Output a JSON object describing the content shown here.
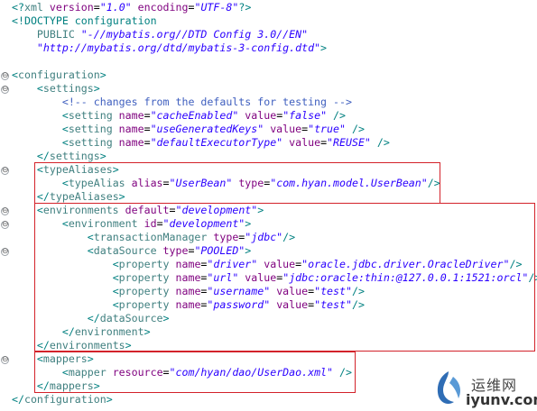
{
  "editor": {
    "lines": [
      [
        [
          "t-bracket",
          "<?"
        ],
        [
          "t-tag",
          "xml "
        ],
        [
          "t-attr",
          "version"
        ],
        [
          "t-plain",
          "="
        ],
        [
          "t-val",
          "\"1.0\""
        ],
        [
          "t-plain",
          " "
        ],
        [
          "t-attr",
          "encoding"
        ],
        [
          "t-plain",
          "="
        ],
        [
          "t-val",
          "\"UTF-8\""
        ],
        [
          "t-bracket",
          "?>"
        ]
      ],
      [
        [
          "t-bracket",
          "<!"
        ],
        [
          "t-doctype",
          "DOCTYPE configuration"
        ]
      ],
      [
        [
          "t-plain",
          "    "
        ],
        [
          "t-dtd",
          "PUBLIC "
        ],
        [
          "t-val",
          "\"-//mybatis.org//DTD Config 3.0//EN\""
        ]
      ],
      [
        [
          "t-plain",
          "    "
        ],
        [
          "t-val",
          "\"http://mybatis.org/dtd/mybatis-3-config.dtd\""
        ],
        [
          "t-bracket",
          ">"
        ]
      ],
      [
        [
          "t-plain",
          ""
        ]
      ],
      [
        [
          "t-bracket",
          "<"
        ],
        [
          "t-tag",
          "configuration"
        ],
        [
          "t-bracket",
          ">"
        ]
      ],
      [
        [
          "t-plain",
          "    "
        ],
        [
          "t-bracket",
          "<"
        ],
        [
          "t-tag",
          "settings"
        ],
        [
          "t-bracket",
          ">"
        ]
      ],
      [
        [
          "t-plain",
          "        "
        ],
        [
          "t-comment",
          "<!-- changes from the defaults for testing -->"
        ]
      ],
      [
        [
          "t-plain",
          "        "
        ],
        [
          "t-bracket",
          "<"
        ],
        [
          "t-tag",
          "setting "
        ],
        [
          "t-attr",
          "name"
        ],
        [
          "t-plain",
          "="
        ],
        [
          "t-val",
          "\"cacheEnabled\""
        ],
        [
          "t-plain",
          " "
        ],
        [
          "t-attr",
          "value"
        ],
        [
          "t-plain",
          "="
        ],
        [
          "t-val",
          "\"false\""
        ],
        [
          "t-plain",
          " "
        ],
        [
          "t-bracket",
          "/>"
        ]
      ],
      [
        [
          "t-plain",
          "        "
        ],
        [
          "t-bracket",
          "<"
        ],
        [
          "t-tag",
          "setting "
        ],
        [
          "t-attr",
          "name"
        ],
        [
          "t-plain",
          "="
        ],
        [
          "t-val",
          "\"useGeneratedKeys\""
        ],
        [
          "t-plain",
          " "
        ],
        [
          "t-attr",
          "value"
        ],
        [
          "t-plain",
          "="
        ],
        [
          "t-val",
          "\"true\""
        ],
        [
          "t-plain",
          " "
        ],
        [
          "t-bracket",
          "/>"
        ]
      ],
      [
        [
          "t-plain",
          "        "
        ],
        [
          "t-bracket",
          "<"
        ],
        [
          "t-tag",
          "setting "
        ],
        [
          "t-attr",
          "name"
        ],
        [
          "t-plain",
          "="
        ],
        [
          "t-val",
          "\"defaultExecutorType\""
        ],
        [
          "t-plain",
          " "
        ],
        [
          "t-attr",
          "value"
        ],
        [
          "t-plain",
          "="
        ],
        [
          "t-val",
          "\"REUSE\""
        ],
        [
          "t-plain",
          " "
        ],
        [
          "t-bracket",
          "/>"
        ]
      ],
      [
        [
          "t-plain",
          "    "
        ],
        [
          "t-bracket",
          "</"
        ],
        [
          "t-tag",
          "settings"
        ],
        [
          "t-bracket",
          ">"
        ]
      ],
      [
        [
          "t-plain",
          "    "
        ],
        [
          "t-bracket",
          "<"
        ],
        [
          "t-tag",
          "typeAliases"
        ],
        [
          "t-bracket",
          ">"
        ]
      ],
      [
        [
          "t-plain",
          "        "
        ],
        [
          "t-bracket",
          "<"
        ],
        [
          "t-tag",
          "typeAlias "
        ],
        [
          "t-attr",
          "alias"
        ],
        [
          "t-plain",
          "="
        ],
        [
          "t-val",
          "\"UserBean\""
        ],
        [
          "t-plain",
          " "
        ],
        [
          "t-attr",
          "type"
        ],
        [
          "t-plain",
          "="
        ],
        [
          "t-val",
          "\"com.hyan.model.UserBean\""
        ],
        [
          "t-bracket",
          "/>"
        ]
      ],
      [
        [
          "t-plain",
          "    "
        ],
        [
          "t-bracket",
          "</"
        ],
        [
          "t-tag",
          "typeAliases"
        ],
        [
          "t-bracket",
          ">"
        ]
      ],
      [
        [
          "t-plain",
          "    "
        ],
        [
          "t-bracket",
          "<"
        ],
        [
          "t-tag",
          "environments "
        ],
        [
          "t-attr",
          "default"
        ],
        [
          "t-plain",
          "="
        ],
        [
          "t-val",
          "\"development\""
        ],
        [
          "t-bracket",
          ">"
        ]
      ],
      [
        [
          "t-plain",
          "        "
        ],
        [
          "t-bracket",
          "<"
        ],
        [
          "t-tag",
          "environment "
        ],
        [
          "t-attr",
          "id"
        ],
        [
          "t-plain",
          "="
        ],
        [
          "t-val",
          "\"development\""
        ],
        [
          "t-bracket",
          ">"
        ]
      ],
      [
        [
          "t-plain",
          "            "
        ],
        [
          "t-bracket",
          "<"
        ],
        [
          "t-tag",
          "transactionManager "
        ],
        [
          "t-attr",
          "type"
        ],
        [
          "t-plain",
          "="
        ],
        [
          "t-val",
          "\"jdbc\""
        ],
        [
          "t-bracket",
          "/>"
        ]
      ],
      [
        [
          "t-plain",
          "            "
        ],
        [
          "t-bracket",
          "<"
        ],
        [
          "t-tag",
          "dataSource "
        ],
        [
          "t-attr",
          "type"
        ],
        [
          "t-plain",
          "="
        ],
        [
          "t-val",
          "\"POOLED\""
        ],
        [
          "t-bracket",
          ">"
        ]
      ],
      [
        [
          "t-plain",
          "                "
        ],
        [
          "t-bracket",
          "<"
        ],
        [
          "t-tag",
          "property "
        ],
        [
          "t-attr",
          "name"
        ],
        [
          "t-plain",
          "="
        ],
        [
          "t-val",
          "\"driver\""
        ],
        [
          "t-plain",
          " "
        ],
        [
          "t-attr",
          "value"
        ],
        [
          "t-plain",
          "="
        ],
        [
          "t-val",
          "\"oracle.jdbc.driver.OracleDriver\""
        ],
        [
          "t-bracket",
          "/>"
        ]
      ],
      [
        [
          "t-plain",
          "                "
        ],
        [
          "t-bracket",
          "<"
        ],
        [
          "t-tag",
          "property "
        ],
        [
          "t-attr",
          "name"
        ],
        [
          "t-plain",
          "="
        ],
        [
          "t-val",
          "\"url\""
        ],
        [
          "t-plain",
          " "
        ],
        [
          "t-attr",
          "value"
        ],
        [
          "t-plain",
          "="
        ],
        [
          "t-val",
          "\"jdbc:oracle:thin:@127.0.0.1:1521:orcl\""
        ],
        [
          "t-bracket",
          "/>"
        ]
      ],
      [
        [
          "t-plain",
          "                "
        ],
        [
          "t-bracket",
          "<"
        ],
        [
          "t-tag",
          "property "
        ],
        [
          "t-attr",
          "name"
        ],
        [
          "t-plain",
          "="
        ],
        [
          "t-val",
          "\"username\""
        ],
        [
          "t-plain",
          " "
        ],
        [
          "t-attr",
          "value"
        ],
        [
          "t-plain",
          "="
        ],
        [
          "t-val",
          "\"test\""
        ],
        [
          "t-bracket",
          "/>"
        ]
      ],
      [
        [
          "t-plain",
          "                "
        ],
        [
          "t-bracket",
          "<"
        ],
        [
          "t-tag",
          "property "
        ],
        [
          "t-attr",
          "name"
        ],
        [
          "t-plain",
          "="
        ],
        [
          "t-val",
          "\"password\""
        ],
        [
          "t-plain",
          " "
        ],
        [
          "t-attr",
          "value"
        ],
        [
          "t-plain",
          "="
        ],
        [
          "t-val",
          "\"test\""
        ],
        [
          "t-bracket",
          "/>"
        ]
      ],
      [
        [
          "t-plain",
          "            "
        ],
        [
          "t-bracket",
          "</"
        ],
        [
          "t-tag",
          "dataSource"
        ],
        [
          "t-bracket",
          ">"
        ]
      ],
      [
        [
          "t-plain",
          "        "
        ],
        [
          "t-bracket",
          "</"
        ],
        [
          "t-tag",
          "environment"
        ],
        [
          "t-bracket",
          ">"
        ]
      ],
      [
        [
          "t-plain",
          "    "
        ],
        [
          "t-bracket",
          "</"
        ],
        [
          "t-tag",
          "environments"
        ],
        [
          "t-bracket",
          ">"
        ]
      ],
      [
        [
          "t-plain",
          "    "
        ],
        [
          "t-bracket",
          "<"
        ],
        [
          "t-tag",
          "mappers"
        ],
        [
          "t-bracket",
          ">"
        ]
      ],
      [
        [
          "t-plain",
          "        "
        ],
        [
          "t-bracket",
          "<"
        ],
        [
          "t-tag",
          "mapper "
        ],
        [
          "t-attr",
          "resource"
        ],
        [
          "t-plain",
          "="
        ],
        [
          "t-val",
          "\"com/hyan/dao/UserDao.xml\""
        ],
        [
          "t-plain",
          " "
        ],
        [
          "t-bracket",
          "/>"
        ]
      ],
      [
        [
          "t-plain",
          "    "
        ],
        [
          "t-bracket",
          "</"
        ],
        [
          "t-tag",
          "mappers"
        ],
        [
          "t-bracket",
          ">"
        ]
      ],
      [
        [
          "t-bracket",
          "</"
        ],
        [
          "t-tag",
          "configuration"
        ],
        [
          "t-bracket",
          ">"
        ]
      ]
    ],
    "fold_marker_glyph": "⊖",
    "highlight_color": "#d3222a"
  },
  "watermark": {
    "cn_text": "运维网",
    "en_text": "iyunv.com"
  }
}
